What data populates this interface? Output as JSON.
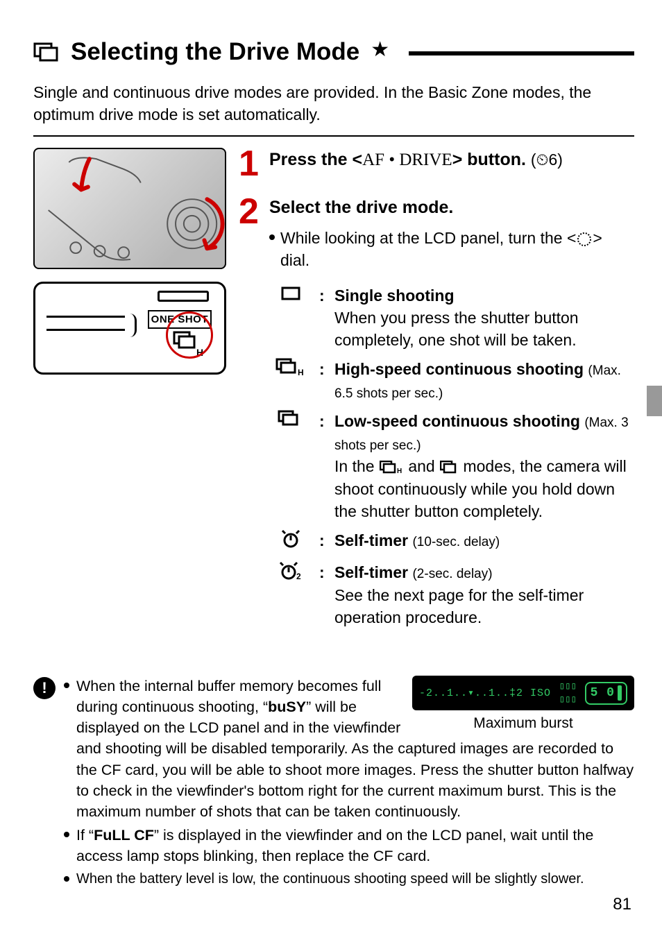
{
  "heading": {
    "title": "Selecting the Drive Mode",
    "icon_name": "drive-mode-icon"
  },
  "intro_text": "Single and continuous drive modes are provided. In the Basic Zone modes, the optimum drive mode is set automatically.",
  "lcd_panel": {
    "one_shot_label": "ONE SHOT"
  },
  "steps": [
    {
      "num": "1",
      "title_before": "Press the <",
      "title_button_glyph": "AF • DRIVE",
      "title_after": "> button.",
      "timer_note": "(⏲6)"
    },
    {
      "num": "2",
      "title": "Select the drive mode.",
      "bullet_before": "While looking at the LCD panel, turn the <",
      "bullet_dial_glyph": "◌",
      "bullet_after": "> dial."
    }
  ],
  "modes": [
    {
      "icon": "single-shot-icon",
      "label": "Single shooting",
      "desc": "When you press the shutter button completely, one shot will be taken."
    },
    {
      "icon": "continuous-high-icon",
      "label": "High-speed continuous shooting",
      "note": "(Max. 6.5 shots per sec.)"
    },
    {
      "icon": "continuous-low-icon",
      "label": "Low-speed continuous shooting",
      "note": "(Max. 3 shots per sec.)",
      "extra": "In the ⬚H and ⬚ modes, the camera will shoot continuously while you hold down the shutter button completely."
    },
    {
      "icon": "self-timer-10-icon",
      "label": "Self-timer",
      "note": "(10-sec. delay)"
    },
    {
      "icon": "self-timer-2-icon",
      "label": "Self-timer",
      "note": "(2-sec. delay)",
      "extra": "See the next page for the self-timer operation procedure."
    }
  ],
  "caution": [
    {
      "text_a": "When the internal buffer memory becomes full during continuous shooting, “",
      "busy": "buSY",
      "text_b": "” will be displayed on the LCD panel and in the viewfinder and shooting will be disabled temporarily. As the captured images are recorded to the CF card, you will be able to shoot more images. Press the shutter button halfway to check in the viewfinder's bottom right for the current maximum burst. This is the maximum number of shots that can be taken continuously."
    },
    {
      "text_a": "If “",
      "full_cf": "FuLL CF",
      "text_b": "” is displayed in the viewfinder and on the LCD panel, wait until the access lamp stops blinking, then replace the CF card."
    },
    {
      "text": "When the battery level is low, the continuous shooting speed will be slightly slower."
    }
  ],
  "viewfinder": {
    "left_segment": "-2..1..▾..1..‡2  ISO",
    "burst_segment": "5 0",
    "caption": "Maximum burst"
  },
  "page_number": "81"
}
